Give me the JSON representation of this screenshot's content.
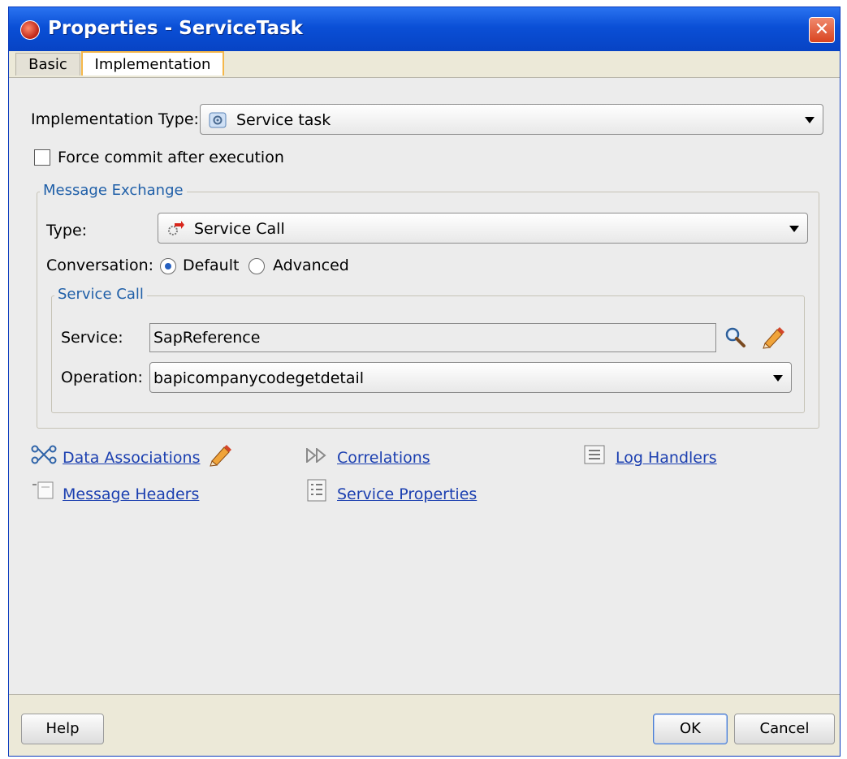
{
  "window": {
    "title": "Properties - ServiceTask",
    "close_glyph": "✕"
  },
  "tabs": [
    {
      "label": "Basic"
    },
    {
      "label": "Implementation"
    }
  ],
  "implementation_type": {
    "label": "Implementation Type:",
    "value": "Service task"
  },
  "force_commit": {
    "label": "Force commit after execution",
    "checked": false
  },
  "message_exchange": {
    "title": "Message Exchange",
    "type_label": "Type:",
    "type_value": "Service Call",
    "conversation_label": "Conversation:",
    "conversation_options": [
      {
        "label": "Default",
        "selected": true
      },
      {
        "label": "Advanced",
        "selected": false
      }
    ]
  },
  "service_call": {
    "title": "Service Call",
    "service_label": "Service:",
    "service_value": "SapReference",
    "operation_label": "Operation:",
    "operation_value": "bapicompanycodegetdetail"
  },
  "links": {
    "data_associations": "Data Associations",
    "correlations": "Correlations",
    "log_handlers": "Log Handlers",
    "message_headers": "Message Headers",
    "service_properties": "Service Properties"
  },
  "buttons": {
    "help": "Help",
    "ok": "OK",
    "cancel": "Cancel"
  },
  "colors": {
    "titlebar": "#0a4fd6",
    "link": "#1b3fb0",
    "group_title": "#1f5fa8",
    "active_tab_border": "#f5b74a"
  }
}
